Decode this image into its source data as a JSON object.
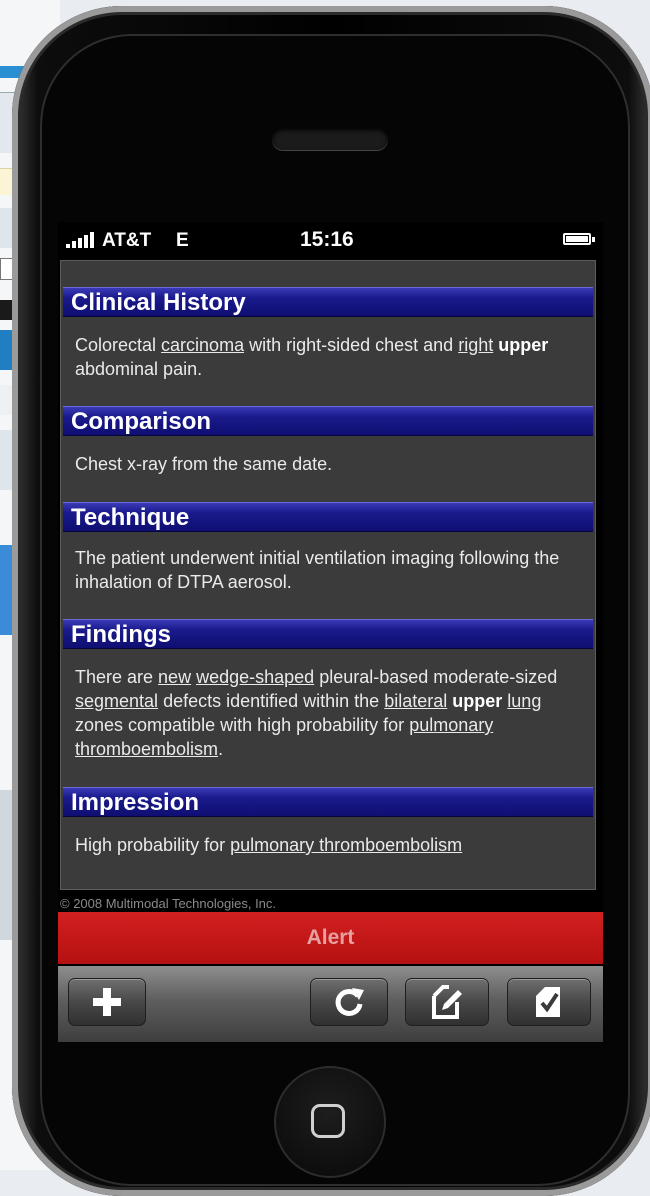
{
  "status_bar": {
    "carrier": "AT&T",
    "network": "E",
    "time": "15:16"
  },
  "report": {
    "sections": [
      {
        "title": "Clinical History"
      },
      {
        "title": "Comparison",
        "text": "Chest x-ray from the same date."
      },
      {
        "title": "Technique",
        "text": "The patient underwent initial ventilation imaging following the inhalation of DTPA aerosol."
      },
      {
        "title": "Findings"
      },
      {
        "title": "Impression"
      }
    ],
    "clinical_history": {
      "t1": "Colorectal ",
      "u1": "carcinoma",
      "t2": " with right-sided chest and ",
      "u2": "right",
      "t3": " ",
      "b1": "upper",
      "t4": " abdominal pain."
    },
    "findings": {
      "t1": "There are ",
      "u1": "new",
      "t2": " ",
      "u2": "wedge-shaped",
      "t3": " pleural-based moderate-sized ",
      "u3": "segmental",
      "t4": " defects identified within the ",
      "u4": "bilateral",
      "t5": " ",
      "b1": "upper",
      "t6": " ",
      "u5": "lung",
      "t7": " zones compatible with high probability for ",
      "u6": "pulmonary thromboembolism",
      "t8": "."
    },
    "impression": {
      "t1": "High probability for ",
      "u1": "pulmonary thromboembolism"
    }
  },
  "copyright": "© 2008 Multimodal Technologies, Inc.",
  "alert_label": "Alert",
  "toolbar": {
    "buttons": [
      {
        "icon": "plus-icon"
      },
      {
        "icon": "refresh-icon"
      },
      {
        "icon": "edit-document-icon"
      },
      {
        "icon": "checked-document-icon"
      }
    ]
  },
  "colors": {
    "section_header": "#1a1a8c",
    "report_background": "#3b3b3b",
    "alert": "#c41818",
    "alert_text": "#e7a0a0"
  }
}
